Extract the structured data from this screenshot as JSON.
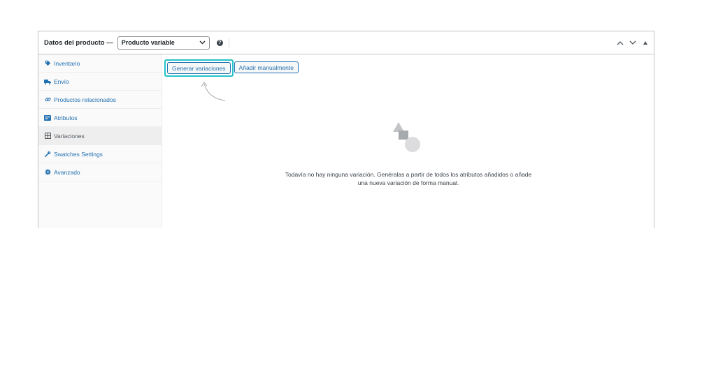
{
  "header": {
    "title": "Datos del producto —",
    "product_type_selected": "Producto variable",
    "help_icon": "question-circle-icon",
    "controls": [
      "chevron-up-icon",
      "chevron-down-icon",
      "triangle-up-icon"
    ]
  },
  "sidebar": {
    "items": [
      {
        "label": "Inventario",
        "icon": "tag-icon"
      },
      {
        "label": "Envío",
        "icon": "truck-icon"
      },
      {
        "label": "Productos relacionados",
        "icon": "link-icon"
      },
      {
        "label": "Atributos",
        "icon": "list-card-icon"
      },
      {
        "label": "Variaciones",
        "icon": "grid-icon"
      },
      {
        "label": "Swatches Settings",
        "icon": "wrench-icon"
      },
      {
        "label": "Avanzado",
        "icon": "gear-icon"
      }
    ],
    "active_index": 4
  },
  "main": {
    "generate_button": "Generar variaciones",
    "add_manual_button": "Añadir manualmente",
    "empty_message": "Todavía no hay ninguna variación. Genéralas a partir de todos los atributos añadidos o añade una nueva variación de forma manual."
  },
  "colors": {
    "link": "#2271b1",
    "highlight": "#25c2c9",
    "border": "#c3c4c7"
  }
}
